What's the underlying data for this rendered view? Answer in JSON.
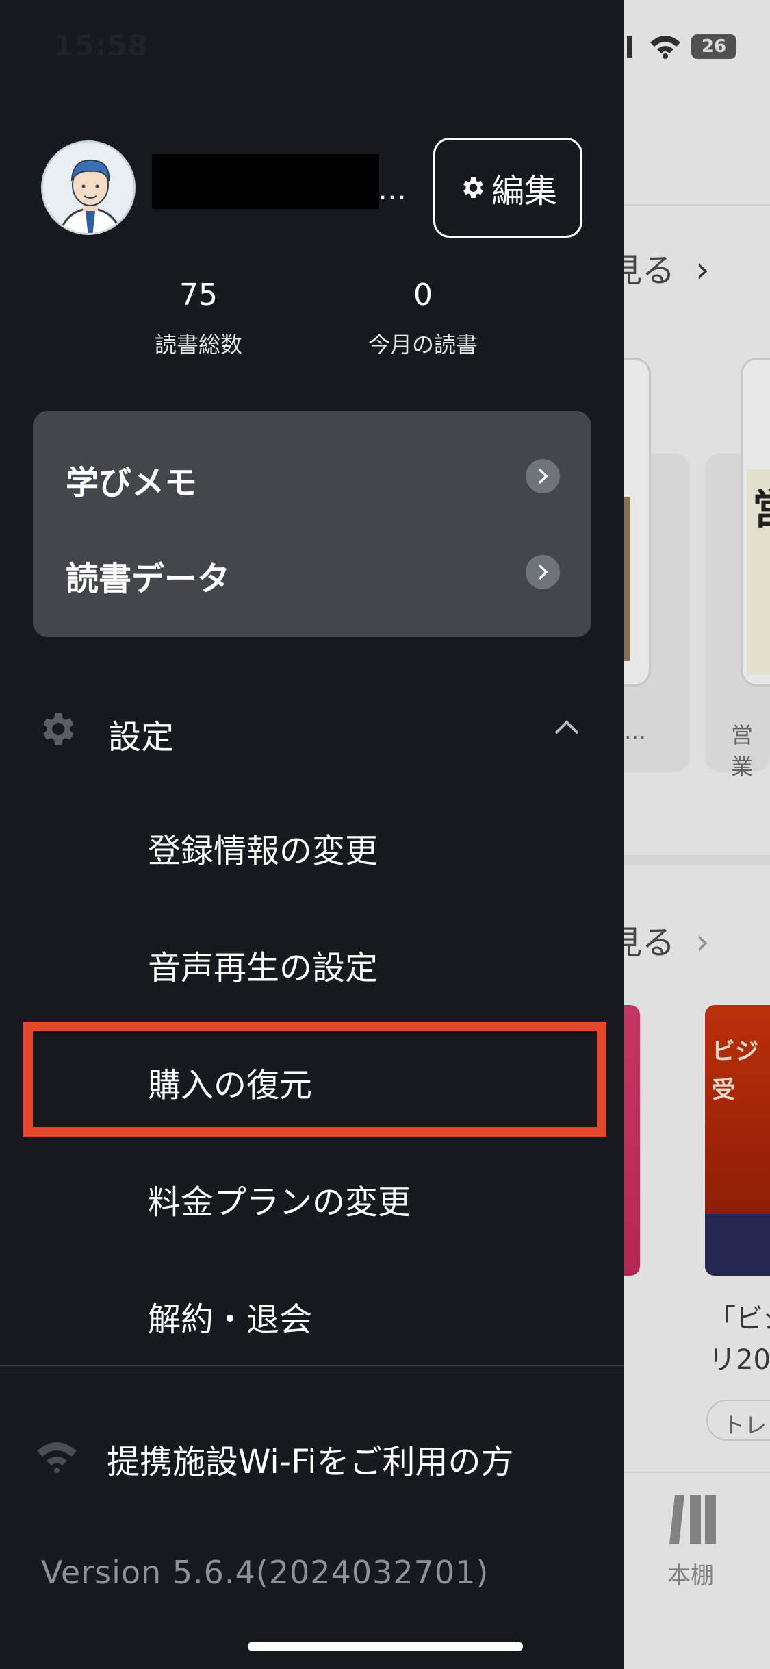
{
  "status_bar": {
    "time": "15:58",
    "battery": "26"
  },
  "profile": {
    "edit_label": "編集",
    "ellipsis": "…",
    "stats": [
      {
        "value": "75",
        "label": "読書総数"
      },
      {
        "value": "0",
        "label": "今月の読書"
      }
    ]
  },
  "card_menu": [
    {
      "label": "学びメモ"
    },
    {
      "label": "読書データ"
    }
  ],
  "settings": {
    "label": "設定",
    "items": [
      {
        "label": "登録情報の変更"
      },
      {
        "label": "音声再生の設定"
      },
      {
        "label": "購入の復元"
      },
      {
        "label": "料金プランの変更"
      },
      {
        "label": "解約・退会"
      }
    ]
  },
  "wifi": {
    "label": "提携施設Wi-Fiをご利用の方"
  },
  "version": "Version 5.6.4(2024032701)",
  "background": {
    "see_more": "見る",
    "caption_1": "…",
    "caption_2": "営業",
    "book_kanji": "営",
    "cover_text": "ビジ\n受",
    "title_2": "「ビジ\nリ20",
    "pill": "トレ",
    "tab_label": "本棚"
  },
  "colors": {
    "highlight": "#e5472b",
    "drawer_bg": "#161a1e",
    "card_bg": "#43474b"
  }
}
